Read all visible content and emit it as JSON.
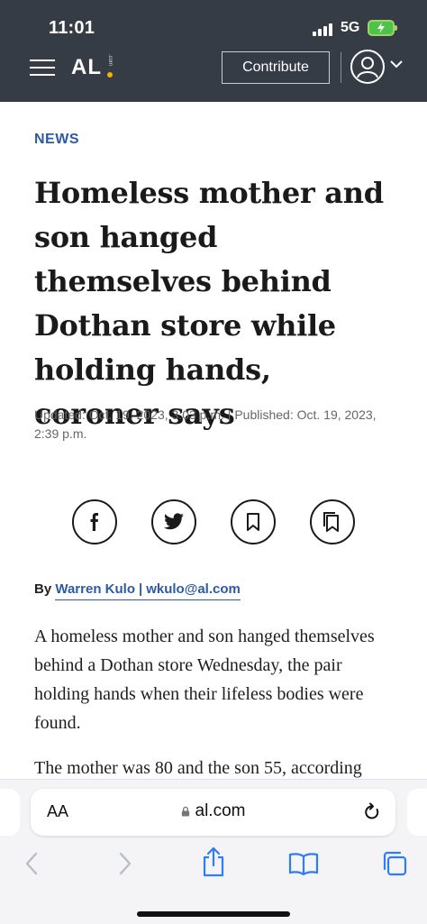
{
  "status_bar": {
    "time": "11:01",
    "network": "5G"
  },
  "site_header": {
    "logo_text": "AL",
    "logo_suffix": ".com",
    "contribute_label": "Contribute"
  },
  "article": {
    "section": "NEWS",
    "headline": "Homeless mother and son hanged themselves behind Dothan store while holding hands, coroner says",
    "dateline": "Updated: Oct. 19, 2023, 3:03 p.m. | Published: Oct. 19, 2023, 2:39 p.m.",
    "byline_prefix": "By",
    "author": "Warren Kulo",
    "author_separator": "|",
    "author_email": "wkulo@al.com",
    "paragraphs": [
      "A homeless mother and son hanged themselves behind a Dothan store Wednesday, the pair holding hands when their lifeless bodies were found.",
      "The mother was 80 and the son 55, according"
    ]
  },
  "share_buttons": [
    "facebook-icon",
    "twitter-icon",
    "bookmark-icon",
    "saved-list-icon"
  ],
  "browser": {
    "aa_label": "AA",
    "url": "al.com"
  },
  "colors": {
    "header_bg": "#363c46",
    "accent_blue": "#2d5aa5",
    "logo_dot": "#f4b200",
    "battery_green": "#4fc24a",
    "toolbar_blue": "#2f7cf6"
  }
}
